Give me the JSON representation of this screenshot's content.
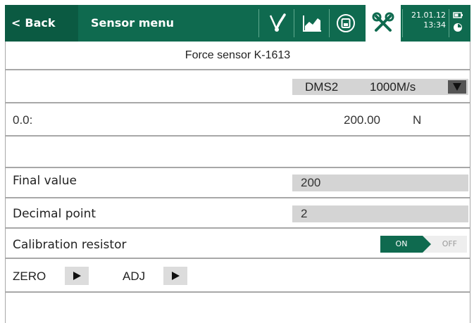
{
  "topbar": {
    "back_label": "Back",
    "title": "Sensor menu",
    "icons": [
      "sensor-probe-icon",
      "chart-icon",
      "disk-icon",
      "tools-icon"
    ],
    "date": "21.01.12",
    "time": "13:34",
    "status_icons": [
      "battery-icon",
      "clock-icon"
    ]
  },
  "colors": {
    "brand": "#0f6a4f",
    "field_bg": "#d4d4d4",
    "divider": "#a8a8a8"
  },
  "sensor_title": "Force sensor K-1613",
  "selector": {
    "channel": "DMS2",
    "rate": "1000M/s",
    "dropdown_icon": "triangle-down-icon"
  },
  "zero_row": {
    "left": "0.0:",
    "value": "200.00",
    "unit": "N"
  },
  "final_value": {
    "label": "Final value",
    "value": "200"
  },
  "decimal_point": {
    "label": "Decimal point",
    "value": "2"
  },
  "calibration": {
    "label": "Calibration resistor",
    "on_label": "ON",
    "off_label": "OFF",
    "state": "ON"
  },
  "actions": {
    "zero_label": "ZERO",
    "adj_label": "ADJ"
  }
}
